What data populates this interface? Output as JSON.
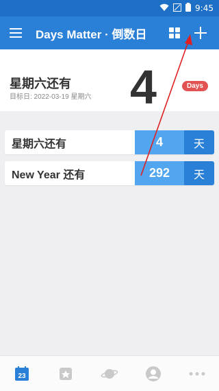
{
  "status": {
    "time": "9:45"
  },
  "appbar": {
    "title": "Days Matter · 倒数日"
  },
  "hero": {
    "label": "星期六还有",
    "target": "目标日: 2022-03-19 星期六",
    "days": "4",
    "badge": "Days"
  },
  "list": [
    {
      "name": "星期六还有",
      "count": "4",
      "unit": "天"
    },
    {
      "name": "New Year 还有",
      "count": "292",
      "unit": "天"
    }
  ],
  "calendar_day": "23",
  "colors": {
    "primary": "#2a7fd6",
    "status": "#1e6fc6",
    "count": "#52a6ef",
    "badge": "#e25252",
    "arrow": "#e02020"
  }
}
